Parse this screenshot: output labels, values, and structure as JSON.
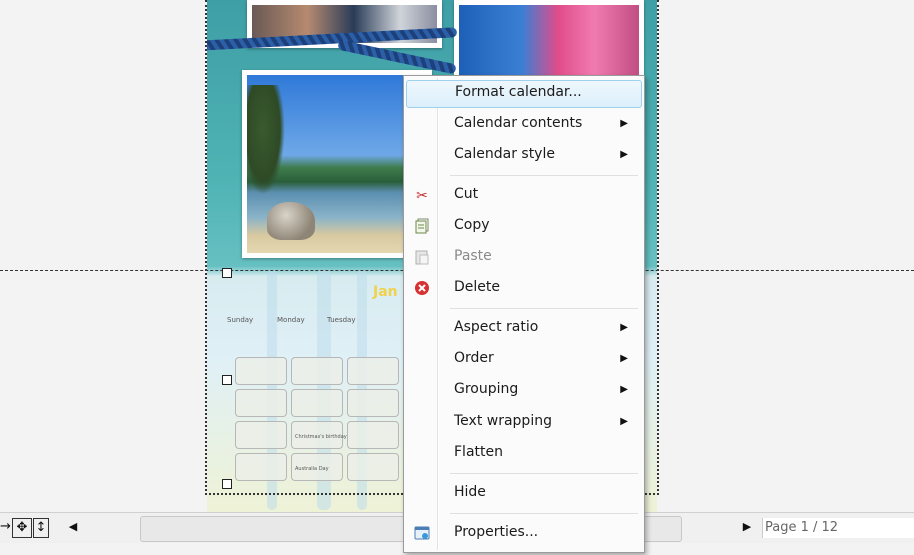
{
  "calendar": {
    "month_partial": "Jan",
    "day_headers": [
      "Sunday",
      "Monday",
      "Tuesday"
    ],
    "cell_labels": [
      "Christmas's birthday",
      "Australia Day"
    ]
  },
  "context_menu": {
    "items": [
      {
        "label": "Format calendar...",
        "submenu": false,
        "icon": "",
        "enabled": true,
        "highlighted": true
      },
      {
        "label": "Calendar contents",
        "submenu": true,
        "icon": "",
        "enabled": true
      },
      {
        "label": "Calendar style",
        "submenu": true,
        "icon": "",
        "enabled": true
      },
      {
        "label": "Cut",
        "submenu": false,
        "icon": "scissors-icon",
        "enabled": true
      },
      {
        "label": "Copy",
        "submenu": false,
        "icon": "copy-icon",
        "enabled": true
      },
      {
        "label": "Paste",
        "submenu": false,
        "icon": "paste-icon",
        "enabled": false
      },
      {
        "label": "Delete",
        "submenu": false,
        "icon": "delete-icon",
        "enabled": true
      },
      {
        "label": "Aspect ratio",
        "submenu": true,
        "icon": "",
        "enabled": true
      },
      {
        "label": "Order",
        "submenu": true,
        "icon": "",
        "enabled": true
      },
      {
        "label": "Grouping",
        "submenu": true,
        "icon": "",
        "enabled": true
      },
      {
        "label": "Text wrapping",
        "submenu": true,
        "icon": "",
        "enabled": true
      },
      {
        "label": "Flatten",
        "submenu": false,
        "icon": "",
        "enabled": true
      },
      {
        "label": "Hide",
        "submenu": false,
        "icon": "",
        "enabled": true
      },
      {
        "label": "Properties...",
        "submenu": false,
        "icon": "properties-icon",
        "enabled": true
      }
    ]
  },
  "statusbar": {
    "page_indicator": "Page 1 / 12"
  },
  "colors": {
    "menu_highlight": "#dbeffb",
    "delete_icon": "#d93030"
  }
}
